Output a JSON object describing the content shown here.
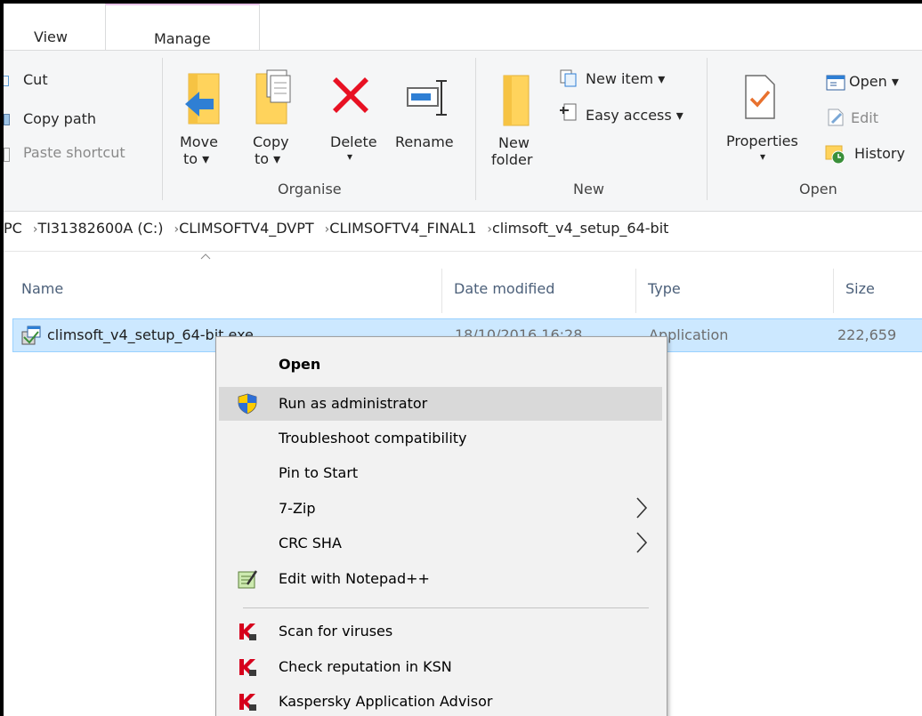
{
  "tabs": {
    "view": "View",
    "manage": "Manage"
  },
  "clipboard": {
    "cut": "Cut",
    "copy_path": "Copy path",
    "paste_shortcut": "Paste shortcut"
  },
  "organise": {
    "move_to_1": "Move",
    "move_to_2": "to ▾",
    "copy_to_1": "Copy",
    "copy_to_2": "to ▾",
    "delete": "Delete",
    "delete_arrow": "▾",
    "rename": "Rename",
    "label": "Organise"
  },
  "new": {
    "new_folder_1": "New",
    "new_folder_2": "folder",
    "new_item": "New item ▾",
    "easy_access": "Easy access ▾",
    "label": "New"
  },
  "open": {
    "properties": "Properties",
    "properties_arrow": "▾",
    "open": "Open ▾",
    "edit": "Edit",
    "history": "History",
    "label": "Open"
  },
  "breadcrumb": [
    "PC",
    "TI31382600A (C:)",
    "CLIMSOFTV4_DVPT",
    "CLIMSOFTV4_FINAL1",
    "climsoft_v4_setup_64-bit"
  ],
  "columns": {
    "name": "Name",
    "date": "Date modified",
    "type": "Type",
    "size": "Size"
  },
  "file": {
    "name": "climsoft_v4_setup_64-bit.exe",
    "date": "18/10/2016 16:28",
    "type": "Application",
    "size": "222,659"
  },
  "context_menu": {
    "open": "Open",
    "run_admin": "Run as administrator",
    "troubleshoot": "Troubleshoot compatibility",
    "pin_start": "Pin to Start",
    "zip": "7-Zip",
    "crc": "CRC SHA",
    "notepad": "Edit with Notepad++",
    "scan": "Scan for viruses",
    "ksn": "Check reputation in KSN",
    "advisor": "Kaspersky Application Advisor"
  },
  "colors": {
    "selection": "#cce8ff",
    "menu_bg": "#f2f2f2",
    "highlight": "#d9d9d9",
    "delete_red": "#e81123",
    "kaspersky_red": "#d6001c"
  }
}
